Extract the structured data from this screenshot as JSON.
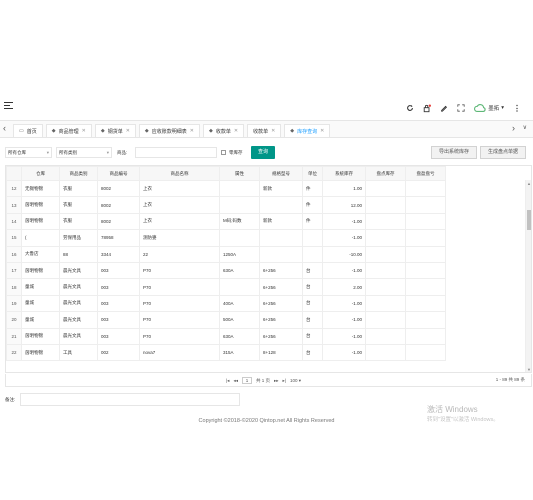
{
  "header": {
    "username": "墨拓"
  },
  "tabs": [
    {
      "label": "首页",
      "icon": "monitor-icon",
      "closable": false,
      "active": false
    },
    {
      "label": "商品管理",
      "icon": "tag-icon",
      "closable": true,
      "active": false
    },
    {
      "label": "钢货单",
      "icon": "tag-icon",
      "closable": true,
      "active": false
    },
    {
      "label": "应收账款明细表",
      "icon": "tag-icon",
      "closable": true,
      "active": false
    },
    {
      "label": "收款单",
      "icon": "tag-icon",
      "closable": true,
      "active": false
    },
    {
      "label": "收款单",
      "icon": "",
      "closable": true,
      "active": false
    },
    {
      "label": "库存查询",
      "icon": "tag-icon",
      "closable": true,
      "active": true
    }
  ],
  "filters": {
    "warehouse": "所有仓库",
    "category": "所有类别",
    "product_label": "商品:",
    "zero_stock_label": "零库存",
    "query_button": "查询",
    "export_button": "导出系统库存",
    "generate_button": "生成盘点单据"
  },
  "table": {
    "columns": [
      "",
      "仓库",
      "商品类别",
      "商品编号",
      "商品名称",
      "属性",
      "规格型号",
      "单位",
      "系统库存",
      "盘点库存",
      "盘盈盘亏"
    ],
    "rows": [
      [
        "12",
        "无锡物锦",
        "衣服",
        "8002",
        "上衣",
        "",
        "新款",
        "件",
        "1.00",
        "",
        ""
      ],
      [
        "13",
        "茵明物锦",
        "衣服",
        "8002",
        "上衣",
        "",
        "",
        "件",
        "12.00",
        "",
        ""
      ],
      [
        "14",
        "茵明物锦",
        "衣服",
        "8002",
        "上衣",
        "M码;码数",
        "新款",
        "件",
        "-1.00",
        "",
        ""
      ],
      [
        "15",
        "(",
        "劳保用品",
        "78958",
        "测防婆",
        "",
        "",
        "",
        "-1.00",
        "",
        ""
      ],
      [
        "16",
        "大鲁店",
        "88",
        "3344",
        "22",
        "1250A",
        "",
        "",
        "-10.00",
        "",
        ""
      ],
      [
        "17",
        "茵明物锦",
        "晨光文具",
        "003",
        "P70",
        "630A",
        "6+256",
        "台",
        "-1.00",
        "",
        ""
      ],
      [
        "18",
        "童城",
        "晨光文具",
        "003",
        "P70",
        "",
        "6+256",
        "台",
        "2.00",
        "",
        ""
      ],
      [
        "19",
        "童城",
        "晨光文具",
        "003",
        "P70",
        "400A",
        "6+256",
        "台",
        "-1.00",
        "",
        ""
      ],
      [
        "20",
        "童城",
        "晨光文具",
        "003",
        "P70",
        "500A",
        "6+256",
        "台",
        "-1.00",
        "",
        ""
      ],
      [
        "21",
        "茵明物锦",
        "晨光文具",
        "003",
        "P70",
        "630A",
        "6+256",
        "台",
        "-1.00",
        "",
        ""
      ],
      [
        "22",
        "茵明物锦",
        "工具",
        "002",
        "nova7",
        "315A",
        "8+128",
        "台",
        "-1.00",
        "",
        ""
      ]
    ]
  },
  "pager": {
    "first": "|◂",
    "prev": "◂◂",
    "page": "1",
    "of_label": "共 1 页",
    "next": "▸▸",
    "last": "▸|",
    "size": "100 ▾",
    "total": "1 - 89 共 89 条"
  },
  "remark_label": "备注:",
  "footer": "Copyright ©2018-©2020 Qintop.net All Rights Reserved",
  "watermark": {
    "title": "激活 Windows",
    "subtitle": "转到\"设置\"以激活 Windows。"
  },
  "colors": {
    "accent": "#009688",
    "active_tab": "#1e9fff",
    "online_icon": "#5fb878"
  }
}
